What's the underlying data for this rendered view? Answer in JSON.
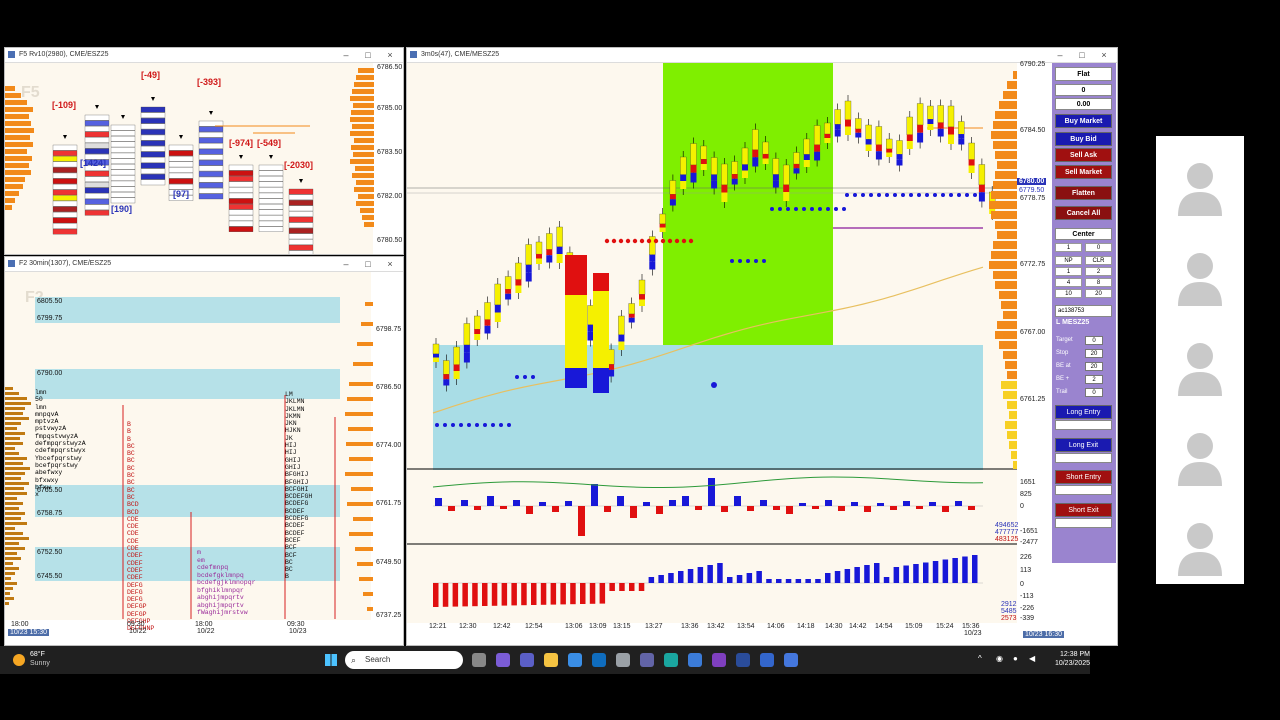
{
  "windows": {
    "footprint": {
      "title": "F5 Rv10(2980), CME/ESZ25",
      "panel_tag": "F5",
      "prices": [
        "6786.50",
        "6785.00",
        "6783.50",
        "6782.00",
        "6780.50"
      ]
    },
    "tpo": {
      "title": "F2 30min(1307), CME/ESZ25",
      "panel_tag": "F2",
      "prices": [
        "6798.75",
        "6786.50",
        "6774.00",
        "6761.75",
        "6749.50",
        "6737.25"
      ],
      "times": [
        "18:00",
        "10/22",
        "09:30",
        "10/22",
        "18:00",
        "10/22",
        "09:30",
        "10/23"
      ],
      "corner_date": "10/23 15:30"
    },
    "main": {
      "title": "3m0s(47), CME/MESZ25",
      "prices": [
        "6790.25",
        "6784.50",
        "6778.75",
        "6772.75",
        "6767.00",
        "6761.25"
      ],
      "last_price": "6780.00",
      "last_price_2": "6779.50",
      "times": [
        "12:21",
        "12:30",
        "12:42",
        "12:54",
        "13:06",
        "13:09",
        "13:15",
        "13:27",
        "13:36",
        "13:42",
        "13:54",
        "14:06",
        "14:18",
        "14:30",
        "14:42",
        "14:54",
        "15:09",
        "15:24",
        "15:36"
      ],
      "time_date": "10/23",
      "corner_date": "10/23 16:30",
      "delta_axis": [
        "1651",
        "825",
        "0",
        "-1651",
        "-2477"
      ],
      "delta_vals": [
        "494652",
        "477777",
        "483125"
      ],
      "cum_axis": [
        "226",
        "113",
        "0",
        "-113",
        "-226",
        "-339"
      ],
      "cum_vals": [
        "2912",
        "5485",
        "2573"
      ]
    }
  },
  "fp_labels": {
    "red": [
      "[-109]",
      "[-49]",
      "[-393]",
      "[-974]",
      "[-549]",
      "[-2030]"
    ],
    "blue": [
      "[1424]",
      "[190]",
      "[97]"
    ],
    "letters": [
      "B",
      "B",
      "S"
    ]
  },
  "tpo_bands": [
    "6805.50",
    "6799.75",
    "6790.00",
    "6765.50",
    "6758.75",
    "6752.50",
    "6745.50"
  ],
  "tpo_lines": [
    "lmn",
    "50",
    "lmn",
    "mnpqvA",
    "mptvzA",
    "pstvwyzA",
    "fmpqstvwyzA",
    "defmpqrstwyzA",
    "cdefmpqrstwyx",
    "Ybcefpqrstwy",
    "bcefpqrstwy",
    "abefwxy",
    "bfxwxy",
    "bfxw",
    "x"
  ],
  "tpo_right": [
    "LM",
    "JKLMN",
    "JKLMN",
    "JKMN",
    "JKN",
    "HJKN",
    "JK",
    "HIJ",
    "HIJ",
    "GHIJ",
    "GHIJ",
    "BFGHIJ",
    "BFGHIJ",
    "BCFGHI",
    "BCDEFGH",
    "BCDEFG",
    "BCDEF",
    "BCDEFG",
    "BCDEF",
    "BCDEF",
    "BCEF",
    "BCF",
    "BCF",
    "BC",
    "BC",
    "B"
  ],
  "tpo_mid_col": [
    "B",
    "B",
    "B",
    "BC",
    "BC",
    "BC",
    "BC",
    "BC",
    "BC",
    "BC",
    "BC",
    "BCD",
    "BCD",
    "CDE",
    "CDE",
    "CDE",
    "CDE",
    "CDE",
    "CDEF",
    "CDEF",
    "CDEF",
    "CDEF",
    "DEFG",
    "DEFG",
    "DEFG",
    "DEFGP",
    "DEFGP",
    "DEFGHP",
    "DEFGHNP"
  ],
  "tpo_mn": [
    "m",
    "em",
    "cdefmnpq",
    "bcdefgklmnpq",
    "bcdefgjklmnopqr",
    "bfghiklmnpqr",
    "abghijmpqrtv",
    "abghijmpqrtv",
    "fWaghijmrstvw"
  ],
  "order_panel": {
    "status": "Flat",
    "qty": "0",
    "pnl": "0.00",
    "buy_market": "Buy Market",
    "buy_bid": "Buy Bid",
    "sell_ask": "Sell Ask",
    "sell_market": "Sell Market",
    "flatten": "Flatten",
    "cancel_all": "Cancel All",
    "center": "Center",
    "qty_field": "1",
    "qty_field2": "0",
    "grid": [
      "NP",
      "CLR",
      "1",
      "2",
      "4",
      "8",
      "10",
      "20"
    ],
    "account": "ac138753",
    "symbol": "L MESZ25",
    "target_lbl": "Target",
    "target_val": "0",
    "stop_lbl": "Stop",
    "stop_val": "20",
    "beat_lbl": "BE at",
    "beat_val": "20",
    "beplus_lbl": "BE +",
    "beplus_val": "2",
    "trail_lbl": "Trail",
    "trail_val": "0",
    "long_entry": "Long Entry",
    "long_exit": "Long Exit",
    "short_entry": "Short Entry",
    "short_exit": "Short Exit"
  },
  "taskbar": {
    "temp": "68°F",
    "weather": "Sunny",
    "search_placeholder": "Search",
    "time": "12:38 PM",
    "date": "10/23/2025"
  },
  "colors": {
    "green_zone": "#7fef00",
    "value_area": "#a9dde6",
    "bull": "#1818d8",
    "bear": "#e01010",
    "bar_yellow": "#f5f000"
  }
}
